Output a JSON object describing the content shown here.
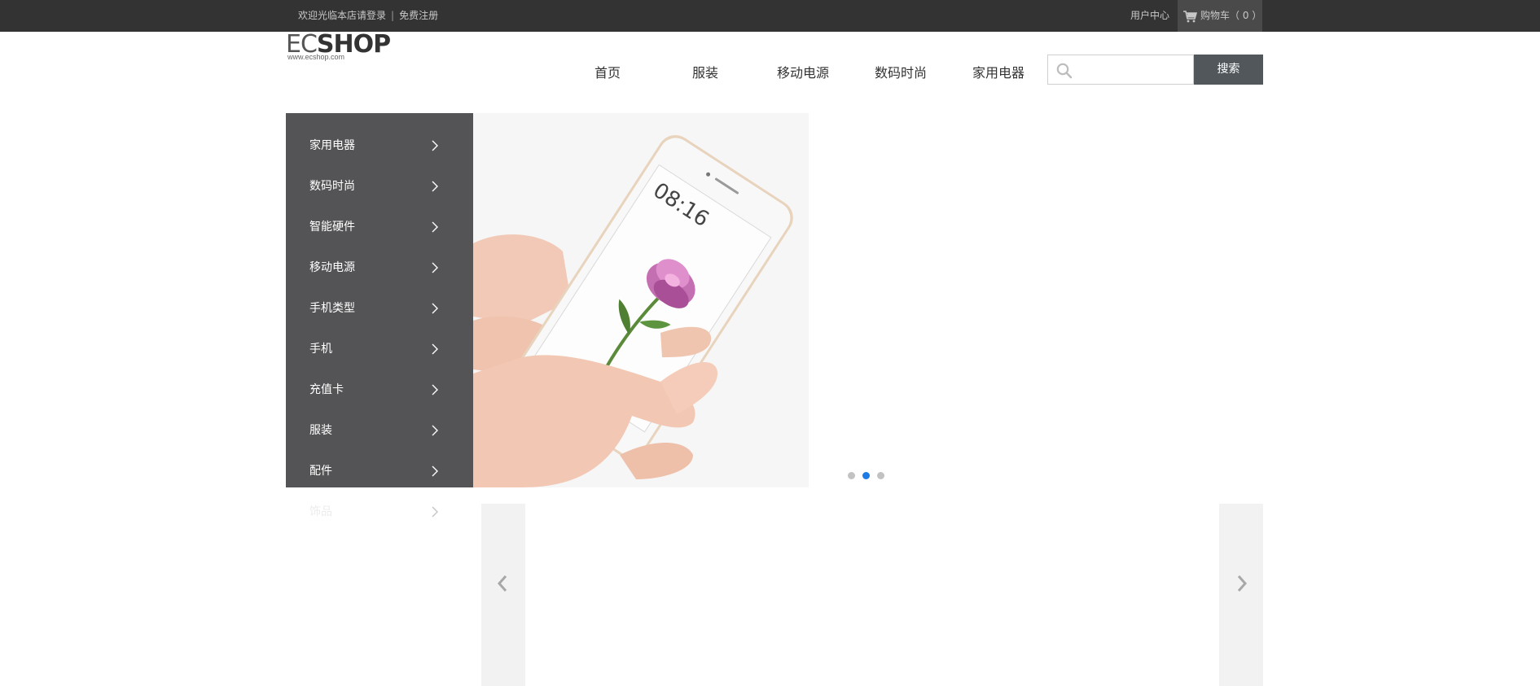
{
  "topbar": {
    "welcome_text": "欢迎光临本店请登录",
    "separator": "|",
    "register_link": "免费注册",
    "user_center": "用户中心",
    "cart_label": "购物车（ 0 ）"
  },
  "logo": {
    "brand_ec": "EC",
    "brand_shop": "SHOP",
    "url_text": "www.ecshop.com"
  },
  "nav": {
    "items": [
      {
        "label": "首页"
      },
      {
        "label": "服装"
      },
      {
        "label": "移动电源"
      },
      {
        "label": "数码时尚"
      },
      {
        "label": "家用电器"
      }
    ]
  },
  "search": {
    "placeholder": "",
    "button_label": "搜索"
  },
  "categories": {
    "items": [
      {
        "label": "家用电器"
      },
      {
        "label": "数码时尚"
      },
      {
        "label": "智能硬件"
      },
      {
        "label": "移动电源"
      },
      {
        "label": "手机类型"
      },
      {
        "label": "手机"
      },
      {
        "label": "充值卡"
      },
      {
        "label": "服装"
      },
      {
        "label": "配件"
      },
      {
        "label": "饰品"
      }
    ]
  },
  "banner": {
    "slides_total": 3,
    "active_slide": 2,
    "phone_time": "08:16",
    "colors": {
      "topbar": "#333333",
      "sidebar": "#545456",
      "search_button": "#51575b",
      "active_dot": "#1e7be6"
    }
  },
  "carousel": {
    "prev_icon": "chevron-left-icon",
    "next_icon": "chevron-right-icon"
  }
}
